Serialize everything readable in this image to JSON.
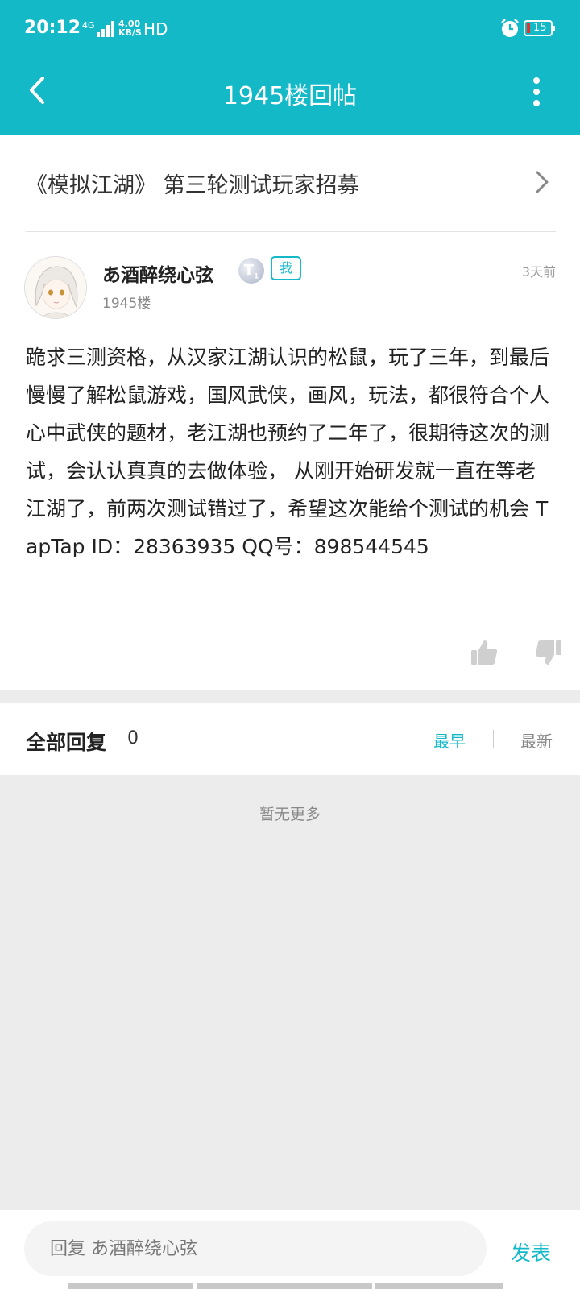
{
  "status_bar": {
    "time": "20:12",
    "network": "4G",
    "speed": "4.00",
    "speed_unit": "KB/S",
    "hd": "HD",
    "battery": "15"
  },
  "nav": {
    "title": "1945楼回帖",
    "back_icon": "chevron-left-icon",
    "more_icon": "more-vertical-icon"
  },
  "topic": {
    "title": "《模拟江湖》 第三轮测试玩家招募"
  },
  "post": {
    "username": "あ酒醉绕心弦",
    "level": "T",
    "level_sub": "1",
    "me_badge": "我",
    "time": "3天前",
    "floor": "1945楼",
    "body": "跪求三测资格，从汉家江湖认识的松鼠，玩了三年，到最后慢慢了解松鼠游戏，国风武侠，画风，玩法，都很符合个人心中武侠的题材，老江湖也预约了二年了，很期待这次的测试，会认认真真的去做体验， 从刚开始研发就一直在等老江湖了，前两次测试错过了，希望这次能给个测试的机会 TapTap ID：28363935 QQ号：898544545"
  },
  "replies": {
    "title": "全部回复",
    "count": "0",
    "sort_earliest": "最早",
    "sort_latest": "最新",
    "empty_text": "暂无更多"
  },
  "composer": {
    "placeholder": "回复 あ酒醉绕心弦",
    "publish_label": "发表"
  },
  "colors": {
    "accent": "#14b9c8",
    "background": "#ececec"
  }
}
